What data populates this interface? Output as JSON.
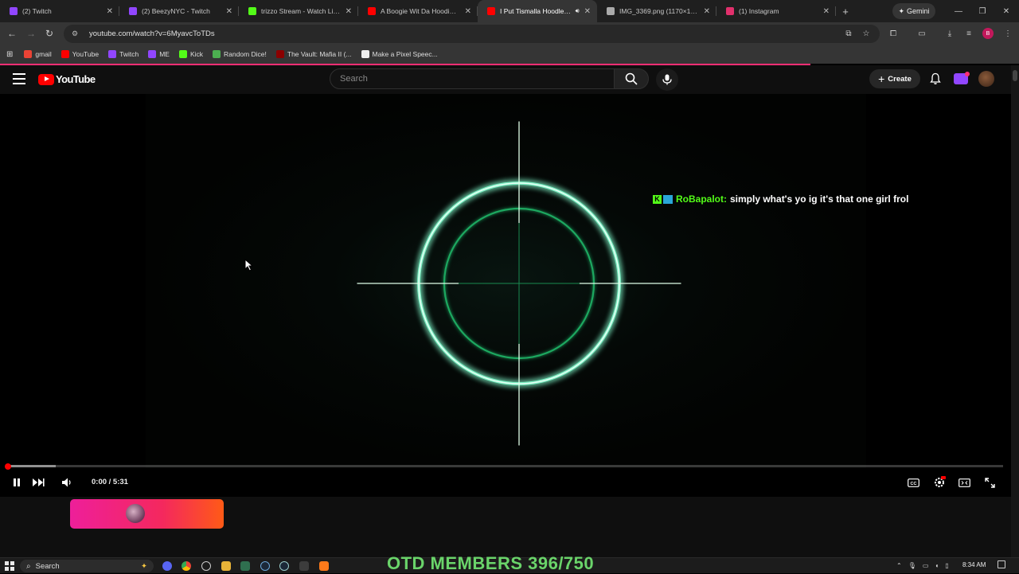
{
  "browser": {
    "tabs": [
      {
        "title": "(2) Twitch",
        "favicon_color": "#9146ff",
        "active": false
      },
      {
        "title": "(2) BeezyNYC - Twitch",
        "favicon_color": "#9146ff",
        "active": false
      },
      {
        "title": "trizzo Stream - Watch Live on",
        "favicon_color": "#53fc18",
        "active": false
      },
      {
        "title": "A Boogie Wit Da Hoodie - W",
        "favicon_color": "#ff0000",
        "active": false
      },
      {
        "title": "I Put Tismalla Hoodlegen",
        "favicon_color": "#ff0000",
        "active": true
      },
      {
        "title": "IMG_3369.png (1170×1738)",
        "favicon_color": "#aaaaaa",
        "active": false
      },
      {
        "title": "(1) Instagram",
        "favicon_color": "#e1306c",
        "active": false
      }
    ],
    "gemini_label": "Gemini",
    "url": "youtube.com/watch?v=6MyavcToTDs",
    "bookmarks": [
      {
        "label": "gmail",
        "color": "#ea4335"
      },
      {
        "label": "YouTube",
        "color": "#ff0000"
      },
      {
        "label": "Twitch",
        "color": "#9146ff"
      },
      {
        "label": "ME",
        "color": "#9146ff"
      },
      {
        "label": "Kick",
        "color": "#53fc18"
      },
      {
        "label": "Random Dice!",
        "color": "#4caf50"
      },
      {
        "label": "The Vault: Mafia II (...",
        "color": "#8b0000"
      },
      {
        "label": "Make a Pixel Speec...",
        "color": "#eeeeee"
      }
    ],
    "profile_initial": "B",
    "accent": "#ff2e74"
  },
  "youtube": {
    "logo_text": "YouTube",
    "search_placeholder": "Search",
    "create_label": "Create"
  },
  "video": {
    "chat_overlay": {
      "username": "RoBapalot:",
      "message": "simply what's yo ig it's that one girl frol",
      "username_color": "#53fc18"
    },
    "time_display": "0:00 / 5:31",
    "progress_fraction": 0.0,
    "crosshair_color": "#39e08a"
  },
  "taskbar": {
    "search_label": "Search",
    "banner_text": "OTD MEMBERS 396/750",
    "banner_color": "#6ad46a",
    "clock": "8:34 AM"
  }
}
